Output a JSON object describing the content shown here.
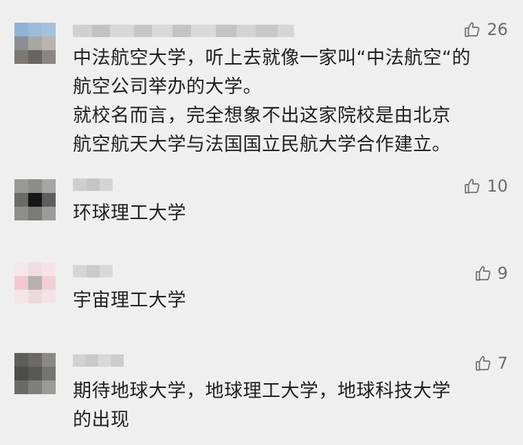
{
  "comments": [
    {
      "likes": "26",
      "text": "中法航空大学，听上去就像一家叫“中法航空“的\n航空公司举办的大学。\n就校名而言，完全想象不出这家院校是由北京\n航空航天大学与法国国立民航大学合作建立。"
    },
    {
      "likes": "10",
      "text": "环球理工大学"
    },
    {
      "likes": "9",
      "text": "宇宙理工大学"
    },
    {
      "likes": "7",
      "text": "期待地球大学，地球理工大学，地球科技大学\n的出现"
    }
  ],
  "icons": {
    "like": "thumbs-up-icon",
    "avatar": "pixelated-avatar"
  },
  "colors": {
    "background": "#efefef",
    "text": "#1f1f1f",
    "meta": "#6b6b6b"
  }
}
